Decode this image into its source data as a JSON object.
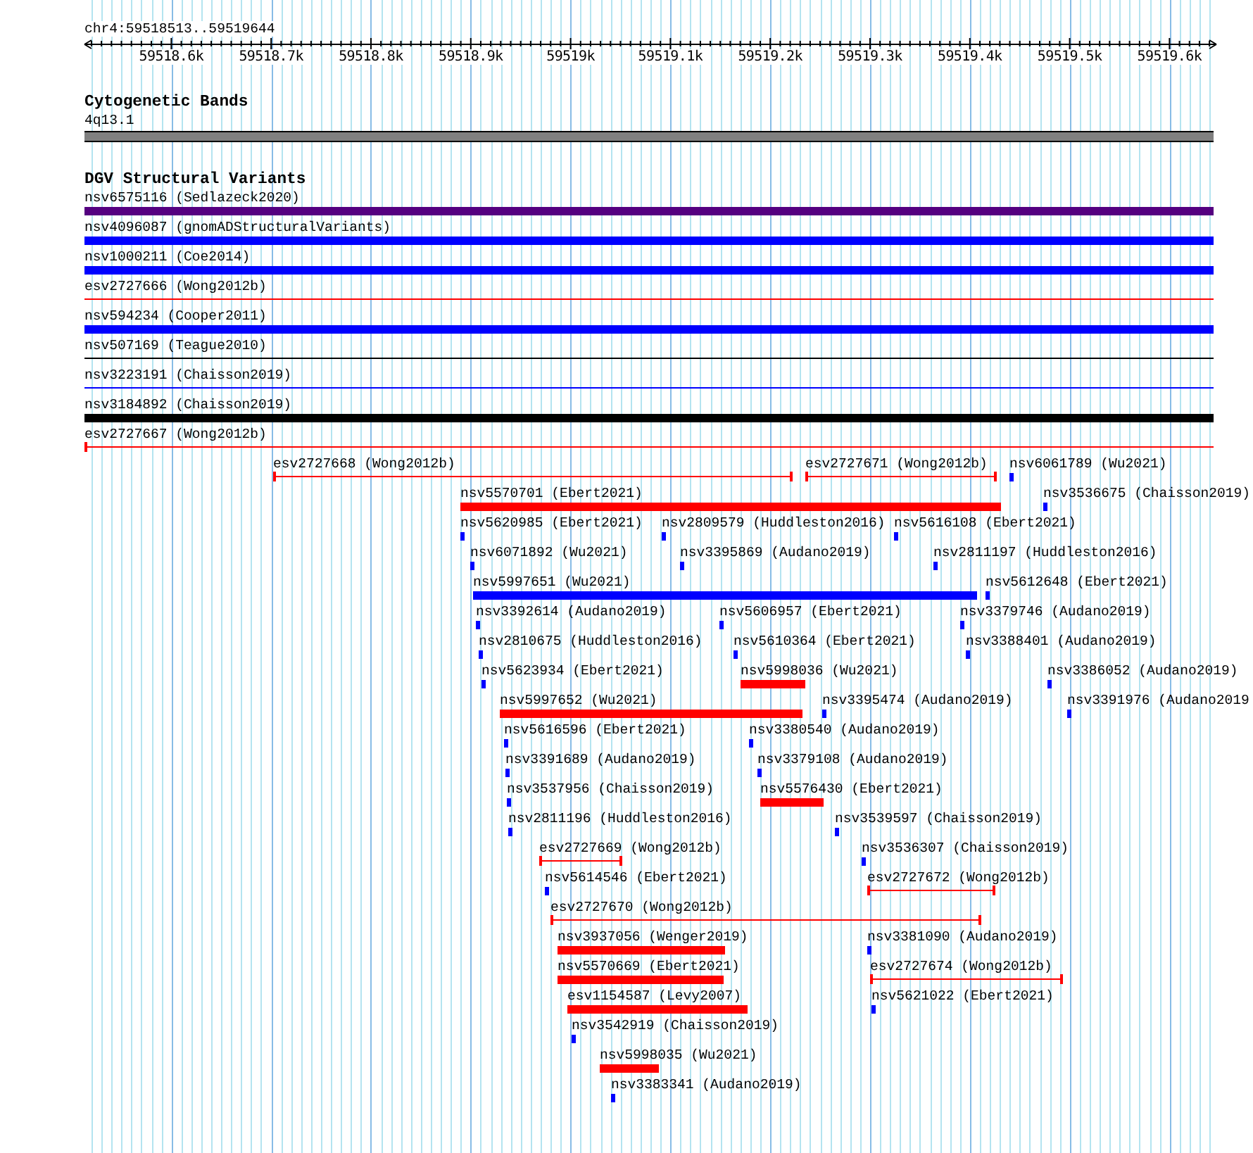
{
  "ruler": {
    "location": "chr4:59518513..59519644",
    "ticks": [
      "59518.6k",
      "59518.7k",
      "59518.8k",
      "59518.9k",
      "59519k",
      "59519.1k",
      "59519.2k",
      "59519.3k",
      "59519.4k",
      "59519.5k",
      "59519.6k"
    ]
  },
  "tracks": [
    {
      "title": "Cytogenetic Bands",
      "features": [
        {
          "label": "4q13.1",
          "kind": "band",
          "color": "#808080"
        }
      ]
    },
    {
      "title": "DGV Structural Variants",
      "features": [
        {
          "label": "nsv6575116 (Sedlazeck2020)",
          "kind": "bar",
          "color": "#550080"
        },
        {
          "label": "nsv4096087 (gnomADStructuralVariants)",
          "kind": "bar",
          "color": "#0000ff"
        },
        {
          "label": "nsv1000211 (Coe2014)",
          "kind": "bar",
          "color": "#0000ff"
        },
        {
          "label": "esv2727666 (Wong2012b)",
          "kind": "line",
          "color": "#ff0000"
        },
        {
          "label": "nsv594234 (Cooper2011)",
          "kind": "bar",
          "color": "#0000ff"
        },
        {
          "label": "nsv507169 (Teague2010)",
          "kind": "line",
          "color": "#000000"
        },
        {
          "label": "nsv3223191 (Chaisson2019)",
          "kind": "line",
          "color": "#0000ff"
        },
        {
          "label": "nsv3184892 (Chaisson2019)",
          "kind": "bar",
          "color": "#000000"
        },
        {
          "label": "esv2727667 (Wong2012b)",
          "kind": "interval",
          "color": "#ff0000"
        },
        {
          "label": "esv2727668 (Wong2012b)",
          "kind": "interval",
          "color": "#ff0000"
        },
        {
          "label": "esv2727671 (Wong2012b)",
          "kind": "interval",
          "color": "#ff0000"
        },
        {
          "label": "nsv6061789 (Wu2021)",
          "kind": "tick",
          "color": "#0000ff"
        },
        {
          "label": "nsv5570701 (Ebert2021)",
          "kind": "bar",
          "color": "#ff0000"
        },
        {
          "label": "nsv3536675 (Chaisson2019)",
          "kind": "tick",
          "color": "#0000ff"
        },
        {
          "label": "nsv5620985 (Ebert2021)",
          "kind": "tick",
          "color": "#0000ff"
        },
        {
          "label": "nsv2809579 (Huddleston2016)",
          "kind": "tick",
          "color": "#0000ff"
        },
        {
          "label": "nsv5616108 (Ebert2021)",
          "kind": "tick",
          "color": "#0000ff"
        },
        {
          "label": "nsv6071892 (Wu2021)",
          "kind": "tick",
          "color": "#0000ff"
        },
        {
          "label": "nsv3395869 (Audano2019)",
          "kind": "tick",
          "color": "#0000ff"
        },
        {
          "label": "nsv2811197 (Huddleston2016)",
          "kind": "tick",
          "color": "#0000ff"
        },
        {
          "label": "nsv5997651 (Wu2021)",
          "kind": "bar",
          "color": "#0000ff"
        },
        {
          "label": "nsv5612648 (Ebert2021)",
          "kind": "tick",
          "color": "#0000ff"
        },
        {
          "label": "nsv3392614 (Audano2019)",
          "kind": "tick",
          "color": "#0000ff"
        },
        {
          "label": "nsv5606957 (Ebert2021)",
          "kind": "tick",
          "color": "#0000ff"
        },
        {
          "label": "nsv3379746 (Audano2019)",
          "kind": "tick",
          "color": "#0000ff"
        },
        {
          "label": "nsv2810675 (Huddleston2016)",
          "kind": "tick",
          "color": "#0000ff"
        },
        {
          "label": "nsv5610364 (Ebert2021)",
          "kind": "tick",
          "color": "#0000ff"
        },
        {
          "label": "nsv3388401 (Audano2019)",
          "kind": "tick",
          "color": "#0000ff"
        },
        {
          "label": "nsv5623934 (Ebert2021)",
          "kind": "tick",
          "color": "#0000ff"
        },
        {
          "label": "nsv5998036 (Wu2021)",
          "kind": "bar",
          "color": "#ff0000"
        },
        {
          "label": "nsv3386052 (Audano2019)",
          "kind": "tick",
          "color": "#0000ff"
        },
        {
          "label": "nsv5997652 (Wu2021)",
          "kind": "bar",
          "color": "#ff0000"
        },
        {
          "label": "nsv3395474 (Audano2019)",
          "kind": "tick",
          "color": "#0000ff"
        },
        {
          "label": "nsv3391976 (Audano2019",
          "kind": "tick",
          "color": "#0000ff"
        },
        {
          "label": "nsv5616596 (Ebert2021)",
          "kind": "tick",
          "color": "#0000ff"
        },
        {
          "label": "nsv3380540 (Audano2019)",
          "kind": "tick",
          "color": "#0000ff"
        },
        {
          "label": "nsv3391689 (Audano2019)",
          "kind": "tick",
          "color": "#0000ff"
        },
        {
          "label": "nsv3379108 (Audano2019)",
          "kind": "tick",
          "color": "#0000ff"
        },
        {
          "label": "nsv3537956 (Chaisson2019)",
          "kind": "tick",
          "color": "#0000ff"
        },
        {
          "label": "nsv5576430 (Ebert2021)",
          "kind": "bar",
          "color": "#ff0000"
        },
        {
          "label": "nsv2811196 (Huddleston2016)",
          "kind": "tick",
          "color": "#0000ff"
        },
        {
          "label": "nsv3539597 (Chaisson2019)",
          "kind": "tick",
          "color": "#0000ff"
        },
        {
          "label": "esv2727669 (Wong2012b)",
          "kind": "interval",
          "color": "#ff0000"
        },
        {
          "label": "nsv3536307 (Chaisson2019)",
          "kind": "tick",
          "color": "#0000ff"
        },
        {
          "label": "nsv5614546 (Ebert2021)",
          "kind": "tick",
          "color": "#0000ff"
        },
        {
          "label": "esv2727672 (Wong2012b)",
          "kind": "interval",
          "color": "#ff0000"
        },
        {
          "label": "esv2727670 (Wong2012b)",
          "kind": "interval",
          "color": "#ff0000"
        },
        {
          "label": "nsv3937056 (Wenger2019)",
          "kind": "bar",
          "color": "#ff0000"
        },
        {
          "label": "nsv3381090 (Audano2019)",
          "kind": "tick",
          "color": "#0000ff"
        },
        {
          "label": "nsv5570669 (Ebert2021)",
          "kind": "bar",
          "color": "#ff0000"
        },
        {
          "label": "esv2727674 (Wong2012b)",
          "kind": "interval",
          "color": "#ff0000"
        },
        {
          "label": "esv1154587 (Levy2007)",
          "kind": "bar",
          "color": "#ff0000"
        },
        {
          "label": "nsv5621022 (Ebert2021)",
          "kind": "tick",
          "color": "#0000ff"
        },
        {
          "label": "nsv3542919 (Chaisson2019)",
          "kind": "tick",
          "color": "#0000ff"
        },
        {
          "label": "nsv5998035 (Wu2021)",
          "kind": "bar",
          "color": "#ff0000"
        },
        {
          "label": "nsv3383341 (Audano2019)",
          "kind": "tick",
          "color": "#0000ff"
        }
      ]
    }
  ]
}
